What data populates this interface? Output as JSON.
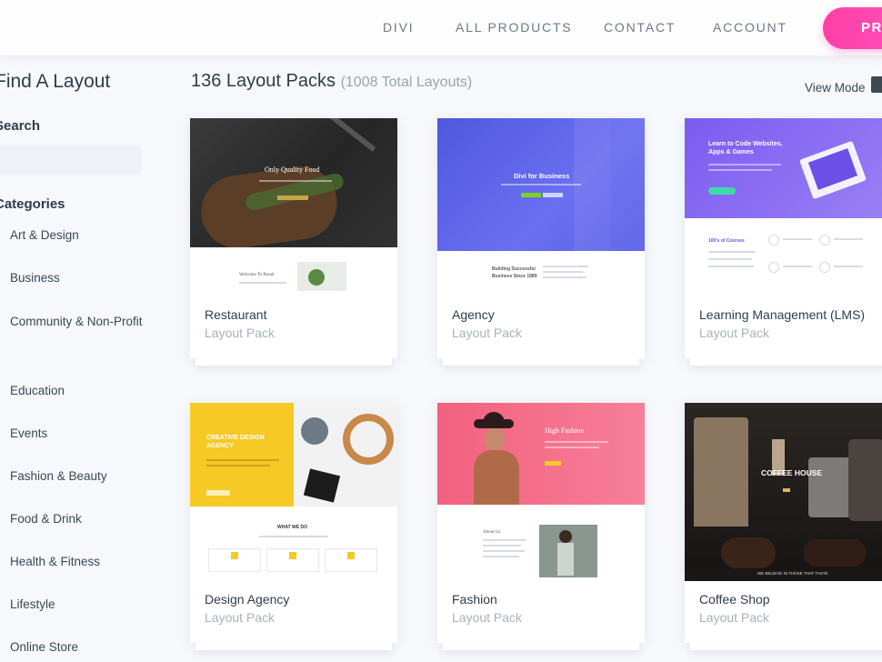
{
  "nav": {
    "links": [
      "DIVI",
      "ALL PRODUCTS",
      "CONTACT",
      "ACCOUNT"
    ],
    "cta_label": "PRICING"
  },
  "sidebar": {
    "title": "Find A Layout",
    "search_label": "Search",
    "search_value": "",
    "categories_label": "Categories",
    "categories": [
      "Art & Design",
      "Business",
      "Community & Non-Profit",
      "Education",
      "Events",
      "Fashion & Beauty",
      "Food & Drink",
      "Health & Fitness",
      "Lifestyle",
      "Online Store"
    ]
  },
  "main": {
    "heading": "136 Layout Packs",
    "total": "(1008 Total Layouts)",
    "view_mode": "View Mode"
  },
  "cards": [
    {
      "title": "Restaurant",
      "subtitle": "Layout Pack",
      "hero_text": "Only Quality Food",
      "lower_text": "Welcome To Bread"
    },
    {
      "title": "Agency",
      "subtitle": "Layout Pack",
      "hero_text": "Divi for Business",
      "lower_text": "Building Successful Business Since 1989"
    },
    {
      "title": "Learning Management (LMS)",
      "subtitle": "Layout Pack",
      "hero_text": "Learn to Code Websites, Apps & Games",
      "lower_text": "100's of Courses"
    },
    {
      "title": "Design Agency",
      "subtitle": "Layout Pack",
      "hero_text": "CREATIVE DESIGN AGENCY",
      "lower_text": "WHAT WE DO"
    },
    {
      "title": "Fashion",
      "subtitle": "Layout Pack",
      "hero_text": "High Fashion",
      "lower_text": "About Us"
    },
    {
      "title": "Coffee Shop",
      "subtitle": "Layout Pack",
      "hero_text": "COFFEE HOUSE",
      "lower_text": "WE BELIEVE IN THOSE THAT TASTE"
    }
  ],
  "colors": {
    "accent_pink": "#ff3fa4",
    "agency_purple": "#5b5ee0",
    "lms_purple": "#8b6cf2",
    "design_yellow": "#f6c924",
    "fashion_pink": "#f6728c"
  }
}
